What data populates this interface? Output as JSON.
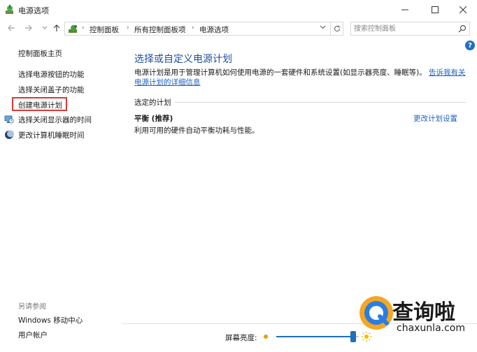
{
  "window": {
    "title": "电源选项",
    "controls": [
      "minimize-icon",
      "maximize-icon",
      "close-icon"
    ]
  },
  "address_bar": {
    "breadcrumbs": [
      "控制面板",
      "所有控制面板项",
      "电源选项"
    ],
    "search_placeholder": "搜索控制面板"
  },
  "sidebar": {
    "home": "控制面板主页",
    "items": [
      {
        "label": "选择电源按钮的功能",
        "icon": ""
      },
      {
        "label": "选择关闭盖子的功能",
        "icon": ""
      },
      {
        "label": "创建电源计划",
        "icon": "",
        "highlighted": true
      },
      {
        "label": "选择关闭显示器的时间",
        "icon": "monitor-clock-icon"
      },
      {
        "label": "更改计算机睡眠时间",
        "icon": "moon-icon"
      }
    ],
    "see_also": "另请参阅",
    "see_also_items": [
      "Windows 移动中心",
      "用户帐户"
    ]
  },
  "main": {
    "title": "选择或自定义电源计划",
    "description": "电源计划是用于管理计算机如何使用电源的一套硬件和系统设置(如显示器亮度、睡眠等)。",
    "description_link": "告诉我有关电源计划的详细信息",
    "section_label": "选定的计划",
    "plan_name": "平衡 (推荐)",
    "plan_description": "利用可用的硬件自动平衡功耗与性能。",
    "plan_change_link": "更改计划设置"
  },
  "brightness": {
    "label": "屏幕亮度:",
    "level_fraction": 0.93
  },
  "watermark": {
    "title": "查询啦",
    "url": "chaxunla.com"
  },
  "colors": {
    "accent": "#1f6fbf",
    "link": "#1e62c4",
    "title": "#1e4f9c",
    "highlight_box": "#d9383a"
  }
}
